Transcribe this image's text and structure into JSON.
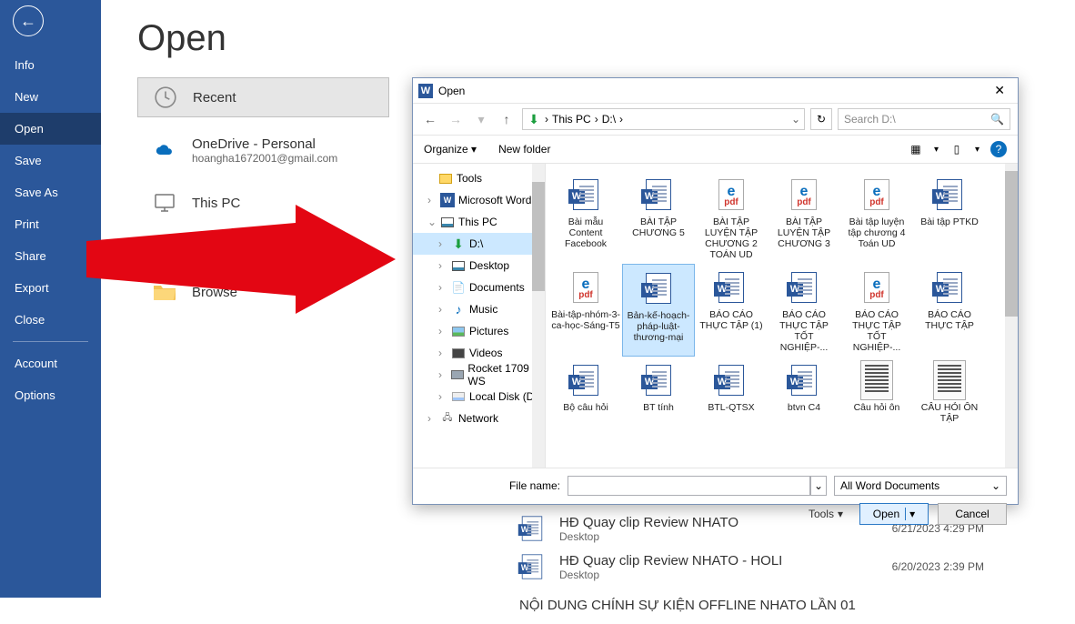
{
  "sidebar": {
    "items": [
      "Info",
      "New",
      "Open",
      "Save",
      "Save As",
      "Print",
      "Share",
      "Export",
      "Close"
    ],
    "bottom": [
      "Account",
      "Options"
    ]
  },
  "page_title": "Open",
  "locations": {
    "recent": "Recent",
    "onedrive": "OneDrive - Personal",
    "onedrive_sub": "hoangha1672001@gmail.com",
    "thispc": "This PC",
    "browse": "Browse"
  },
  "bg_files": [
    {
      "title": "HĐ Quay clip Review NHATO",
      "sub": "Desktop",
      "date": "6/21/2023 4:29 PM"
    },
    {
      "title": "HĐ Quay clip Review NHATO - HOLI",
      "sub": "Desktop",
      "date": "6/20/2023 2:39 PM"
    },
    {
      "title": "NỘI DUNG CHÍNH SỰ KIỆN OFFLINE NHATO LẦN 01",
      "sub": "",
      "date": ""
    }
  ],
  "dialog": {
    "title": "Open",
    "breadcrumb": [
      "This PC",
      "D:\\"
    ],
    "search_placeholder": "Search D:\\",
    "organize": "Organize",
    "newfolder": "New folder",
    "tree": [
      "Tools",
      "Microsoft Word",
      "This PC",
      "D:\\",
      "Desktop",
      "Documents",
      "Music",
      "Pictures",
      "Videos",
      "Rocket 1709 WS",
      "Local Disk (D:)",
      "Network"
    ],
    "files": [
      {
        "name": "Bài mẫu Content Facebook",
        "icon": "word"
      },
      {
        "name": "BÀI TẬP CHƯƠNG 5",
        "icon": "word"
      },
      {
        "name": "BÀI TẬP LUYỆN TẬP CHƯƠNG 2 TOÁN UD",
        "icon": "pdf"
      },
      {
        "name": "BÀI TẬP LUYỆN TẬP CHƯƠNG 3",
        "icon": "pdf"
      },
      {
        "name": "Bài tập luyện tập chương 4 Toán UD",
        "icon": "pdf"
      },
      {
        "name": "Bài tập PTKD",
        "icon": "word"
      },
      {
        "name": "Bài-tập-nhóm-3-ca-học-Sáng-T5",
        "icon": "pdf"
      },
      {
        "name": "Bản-kế-hoạch-pháp-luật-thương-mại",
        "icon": "word",
        "selected": true
      },
      {
        "name": "BÁO CÁO THỰC TẬP (1)",
        "icon": "word"
      },
      {
        "name": "BÁO CÁO THỰC TẬP TỐT NGHIỆP-...",
        "icon": "word"
      },
      {
        "name": "BÁO CÁO THỰC TẬP TỐT NGHIỆP-...",
        "icon": "pdf"
      },
      {
        "name": "BÁO CÁO THỰC TẬP",
        "icon": "word"
      },
      {
        "name": "Bộ câu hỏi",
        "icon": "word"
      },
      {
        "name": "BT tính",
        "icon": "word"
      },
      {
        "name": "BTL-QTSX",
        "icon": "word"
      },
      {
        "name": "btvn C4",
        "icon": "word"
      },
      {
        "name": "Câu hỏi ôn",
        "icon": "doc"
      },
      {
        "name": "CÂU HỎI ÔN TẬP",
        "icon": "doc"
      }
    ],
    "filename_label": "File name:",
    "filter": "All Word Documents",
    "tools": "Tools",
    "open_btn": "Open",
    "cancel_btn": "Cancel"
  }
}
